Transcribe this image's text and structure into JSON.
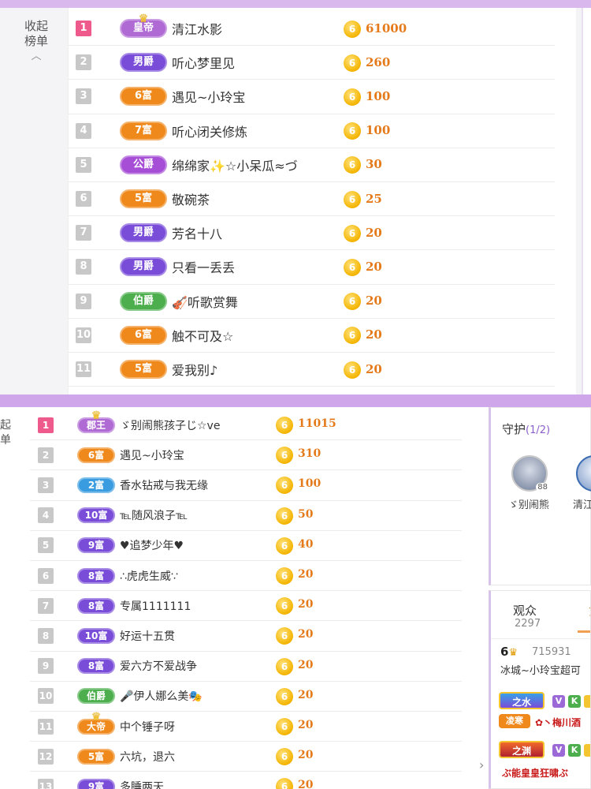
{
  "colors": {
    "frame_purple": "#cfa6ea",
    "rank_first": "#ef5a8c",
    "rank_other": "#c8c8c8",
    "coin": "#f4b400",
    "amount": "#e47a1a",
    "badge_royal": "#b06ad4",
    "badge_rich": "#f0891c",
    "badge_blue": "#3a9ce0",
    "badge_green": "#4cae4c",
    "badge_violet": "#7a4dd8"
  },
  "panel1": {
    "collapse_label": "收起\n榜单",
    "rows": [
      {
        "rank": "1",
        "badge": "皇帝",
        "badge_color": "#b06ad4",
        "name": "清江水影",
        "amount": "61000"
      },
      {
        "rank": "2",
        "badge": "男爵",
        "badge_color": "#7a4dd8",
        "name": "听心梦里见",
        "amount": "260"
      },
      {
        "rank": "3",
        "badge": "6富",
        "badge_color": "#f0891c",
        "name": "遇见~小玲宝",
        "amount": "100"
      },
      {
        "rank": "4",
        "badge": "7富",
        "badge_color": "#f0891c",
        "name": "听心闭关修炼",
        "amount": "100"
      },
      {
        "rank": "5",
        "badge": "公爵",
        "badge_color": "#a64fd6",
        "name": "绵绵家✨☆小呆瓜≈づ",
        "amount": "30"
      },
      {
        "rank": "6",
        "badge": "5富",
        "badge_color": "#f0891c",
        "name": "敬碗茶",
        "amount": "25"
      },
      {
        "rank": "7",
        "badge": "男爵",
        "badge_color": "#7a4dd8",
        "name": "芳名十八",
        "amount": "20"
      },
      {
        "rank": "8",
        "badge": "男爵",
        "badge_color": "#7a4dd8",
        "name": "只看一丢丢",
        "amount": "20"
      },
      {
        "rank": "9",
        "badge": "伯爵",
        "badge_color": "#4cae4c",
        "name": "🎻听歌赏舞",
        "amount": "20"
      },
      {
        "rank": "10",
        "badge": "6富",
        "badge_color": "#f0891c",
        "name": "触不可及☆",
        "amount": "20"
      },
      {
        "rank": "11",
        "badge": "5富",
        "badge_color": "#f0891c",
        "name": "爱我别♪",
        "amount": "20"
      }
    ]
  },
  "panel2": {
    "collapse_label": "起\n单",
    "rows": [
      {
        "rank": "1",
        "badge": "郡王",
        "badge_color": "#b06ad4",
        "name": "ゞ别闹熊孩子じ☆ve",
        "amount": "11015"
      },
      {
        "rank": "2",
        "badge": "6富",
        "badge_color": "#f0891c",
        "name": "遇见~小玲宝",
        "amount": "310"
      },
      {
        "rank": "3",
        "badge": "2富",
        "badge_color": "#3a9ce0",
        "name": "香水钻戒与我无缘",
        "amount": "100"
      },
      {
        "rank": "4",
        "badge": "10富",
        "badge_color": "#7a4dd8",
        "name": "℡随风浪子℡",
        "amount": "50"
      },
      {
        "rank": "5",
        "badge": "9富",
        "badge_color": "#7a4dd8",
        "name": "♥追梦少年♥",
        "amount": "40"
      },
      {
        "rank": "6",
        "badge": "8富",
        "badge_color": "#7a4dd8",
        "name": "∴虎虎生威∵",
        "amount": "20"
      },
      {
        "rank": "7",
        "badge": "8富",
        "badge_color": "#7a4dd8",
        "name": "专属1111111",
        "amount": "20"
      },
      {
        "rank": "8",
        "badge": "10富",
        "badge_color": "#7a4dd8",
        "name": "好运十五贯",
        "amount": "20"
      },
      {
        "rank": "9",
        "badge": "8富",
        "badge_color": "#7a4dd8",
        "name": "爱六方不爱战争",
        "amount": "20"
      },
      {
        "rank": "10",
        "badge": "伯爵",
        "badge_color": "#4cae4c",
        "name": "🎤伊人娜么美🎭",
        "amount": "20"
      },
      {
        "rank": "11",
        "badge": "大帝",
        "badge_color": "#f0891c",
        "name": "中个锤子呀",
        "amount": "20"
      },
      {
        "rank": "12",
        "badge": "5富",
        "badge_color": "#f0891c",
        "name": "六坑，退六",
        "amount": "20"
      },
      {
        "rank": "13",
        "badge": "9富",
        "badge_color": "#7a4dd8",
        "name": "多睡两天",
        "amount": "20"
      }
    ]
  },
  "guard": {
    "title": "守护",
    "count": "(1/2)",
    "members": [
      {
        "name": "ゞ别闹熊",
        "level": "88"
      },
      {
        "name": "清江"
      }
    ]
  },
  "audience": {
    "tab_label": "观众",
    "tab_count": "2297",
    "tab2_label": "贡",
    "entry": {
      "level": "6",
      "id": "715931",
      "text": "冰城~小玲宝超可"
    },
    "badge1": "之水",
    "badge1_sub": "凌寒",
    "badge1_text": "✿丶梅川酒",
    "badge2": "之渊",
    "badge2_text": "ぶ能皇皇狂啸ぶ"
  }
}
